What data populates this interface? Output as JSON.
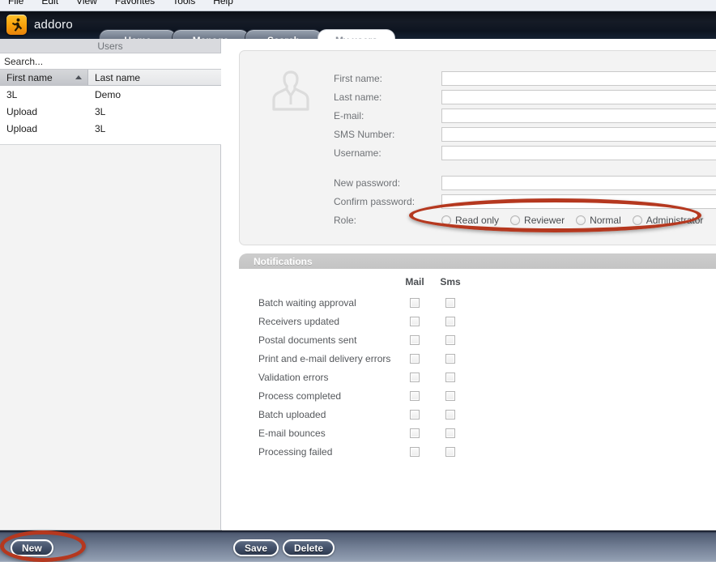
{
  "browser": {
    "menu_items": [
      "File",
      "Edit",
      "View",
      "Favorites",
      "Tools",
      "Help"
    ]
  },
  "header": {
    "brand_name": "addoro",
    "logo_icon": "addoro-runner-logo-icon",
    "brand_color": "#f8a20c",
    "background_color": "#101722",
    "tabs": [
      {
        "label": "Home",
        "active": false
      },
      {
        "label": "Manage",
        "active": false
      },
      {
        "label": "Search",
        "active": false
      },
      {
        "label": "My users",
        "active": true
      }
    ]
  },
  "sidebar": {
    "title": "Users",
    "search": {
      "value": "",
      "placeholder": "Search..."
    },
    "grid": {
      "columns": [
        {
          "label": "First name",
          "sorted": true,
          "sort_direction": "asc"
        },
        {
          "label": "Last name",
          "sorted": false,
          "sort_direction": ""
        }
      ],
      "rows": [
        {
          "first_name": "3L",
          "last_name": "Demo"
        },
        {
          "first_name": "Upload",
          "last_name": "3L"
        },
        {
          "first_name": "Upload",
          "last_name": "3L"
        }
      ]
    }
  },
  "form": {
    "avatar_icon": "user-silhouette-icon",
    "fields": [
      {
        "label": "First name:",
        "value": "",
        "placeholder": ""
      },
      {
        "label": "Last name:",
        "value": "",
        "placeholder": ""
      },
      {
        "label": "E-mail:",
        "value": "",
        "placeholder": ""
      },
      {
        "label": "SMS Number:",
        "value": "",
        "placeholder": ""
      },
      {
        "label": "Username:",
        "value": "",
        "placeholder": ""
      }
    ],
    "password_fields": [
      {
        "label": "New password:",
        "value": "",
        "placeholder": ""
      },
      {
        "label": "Confirm password:",
        "value": "",
        "placeholder": ""
      }
    ],
    "role": {
      "label": "Role:",
      "selected": "",
      "options": [
        {
          "label": "Read only",
          "checked": false
        },
        {
          "label": "Reviewer",
          "checked": false
        },
        {
          "label": "Normal",
          "checked": false
        },
        {
          "label": "Administrator",
          "checked": false
        }
      ]
    }
  },
  "notifications": {
    "title": "Notifications",
    "columns": [
      "Mail",
      "Sms"
    ],
    "rows": [
      {
        "label": "Batch waiting approval",
        "mail": false,
        "sms": false
      },
      {
        "label": "Receivers updated",
        "mail": false,
        "sms": false
      },
      {
        "label": "Postal documents sent",
        "mail": false,
        "sms": false
      },
      {
        "label": "Print and e-mail delivery errors",
        "mail": false,
        "sms": false
      },
      {
        "label": "Validation errors",
        "mail": false,
        "sms": false
      },
      {
        "label": "Process completed",
        "mail": false,
        "sms": false
      },
      {
        "label": "Batch uploaded",
        "mail": false,
        "sms": false
      },
      {
        "label": "E-mail bounces",
        "mail": false,
        "sms": false
      },
      {
        "label": "Processing failed",
        "mail": false,
        "sms": false
      }
    ]
  },
  "toolbar": {
    "new_label": "New",
    "save_label": "Save",
    "delete_label": "Delete"
  },
  "annotations": {
    "highlight_color": "#b5381f",
    "targets": [
      "role-radio-group",
      "new-button"
    ]
  }
}
